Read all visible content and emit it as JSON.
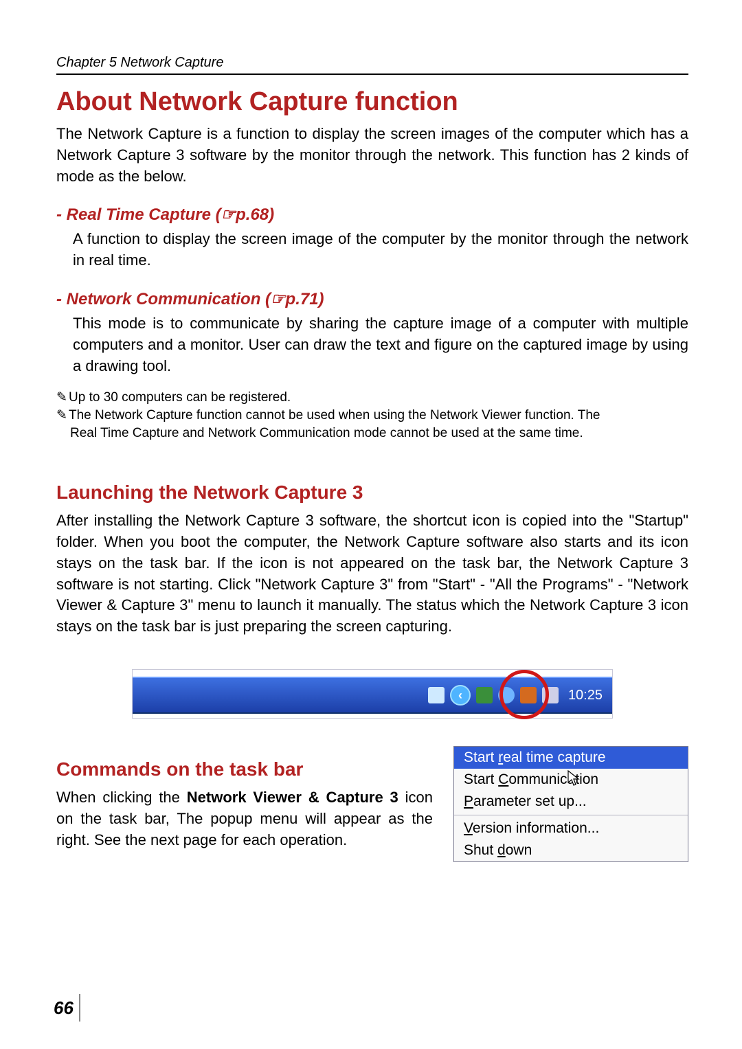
{
  "header": {
    "chapter": "Chapter 5 Network Capture"
  },
  "title": "About Network Capture function",
  "intro": "The Network Capture is a function to display the screen images of the computer which has a Network Capture 3 software by the monitor through the network. This function has 2 kinds of mode as the below.",
  "modes": {
    "rtc_title": "- Real Time Capture (☞p.68)",
    "rtc_body": "A function to display the screen image of the computer by the monitor through the network in real time.",
    "nc_title": "- Network Communication (☞p.71)",
    "nc_body": "This mode is to communicate by sharing the capture image of a computer with multiple computers and a monitor. User can draw the text and figure on the captured image by using a drawing tool."
  },
  "notes": {
    "n1": "Up to 30 computers can be registered.",
    "n2a": "The Network Capture function cannot be used when using the Network Viewer function. The",
    "n2b": "Real Time Capture and Network Communication mode cannot be used at the same time."
  },
  "launch": {
    "title": "Launching the Network Capture 3",
    "body": "After installing the Network Capture 3 software, the shortcut icon is copied into the \"Startup\" folder. When you boot the computer, the Network Capture software also starts and its icon stays on the task bar. If the icon is not appeared on the task bar, the Network Capture 3 software is not starting. Click \"Network Capture 3\" from \"Start\" - \"All the Programs\" - \"Network Viewer & Capture 3\" menu to launch it manually. The status which the Network Capture 3 icon stays on the task bar is just preparing the screen capturing."
  },
  "taskbar": {
    "clock": "10:25"
  },
  "commands": {
    "title": "Commands on the task bar",
    "body_pre": "When clicking the ",
    "body_bold": "Network Viewer & Capture 3",
    "body_post": " icon on the task bar, The popup menu will appear as the right. See the next page for each operation."
  },
  "popup": {
    "item1_pre": "Start ",
    "item1_u": "r",
    "item1_post": "eal time capture",
    "item2_pre": "Start ",
    "item2_u": "C",
    "item2_post": "ommunication",
    "item3_u": "P",
    "item3_post": "arameter set up...",
    "item4_u": "V",
    "item4_post": "ersion information...",
    "item5_pre": "Shut ",
    "item5_u": "d",
    "item5_post": "own"
  },
  "page_number": "66"
}
